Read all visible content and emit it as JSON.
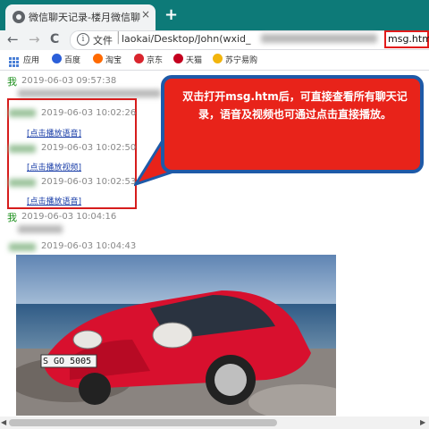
{
  "tab": {
    "title": "微信聊天记录-楼月微信聊天记录",
    "close": "×"
  },
  "new_tab": "+",
  "nav": {
    "back": "←",
    "forward": "→",
    "reload": "C"
  },
  "address": {
    "scheme": "文件",
    "path": "laokai/Desktop/John(wxid_",
    "path_end": ")/",
    "file": "msg.htm"
  },
  "bookmarks": [
    {
      "label": "应用",
      "color": "#e04b2a"
    },
    {
      "label": "百度",
      "color": "#2b5fd9"
    },
    {
      "label": "淘宝",
      "color": "#ff6a00"
    },
    {
      "label": "京东",
      "color": "#d9252e"
    },
    {
      "label": "天猫",
      "color": "#c4001f"
    },
    {
      "label": "苏宁易购",
      "color": "#f2b50d"
    }
  ],
  "messages": [
    {
      "sender": "我",
      "time": "2019-06-03 09:57:38"
    },
    {
      "time": "2019-06-03 10:02:26",
      "link": "[点击播放语音]"
    },
    {
      "time": "2019-06-03 10:02:50",
      "link": "[点击播放视频]"
    },
    {
      "time": "2019-06-03 10:02:53",
      "link": "[点击播放语音]"
    },
    {
      "sender": "我",
      "time": "2019-06-03 10:04:16"
    },
    {
      "time": "2019-06-03 10:04:43"
    }
  ],
  "callout": {
    "text": "双击打开msg.htm后，可直接查看所有聊天记录，语音及视频也可通过点击直接播放。"
  },
  "car": {
    "plate": "S GO 5005"
  },
  "scrollbar": {
    "left": "◀",
    "right": "▶"
  }
}
